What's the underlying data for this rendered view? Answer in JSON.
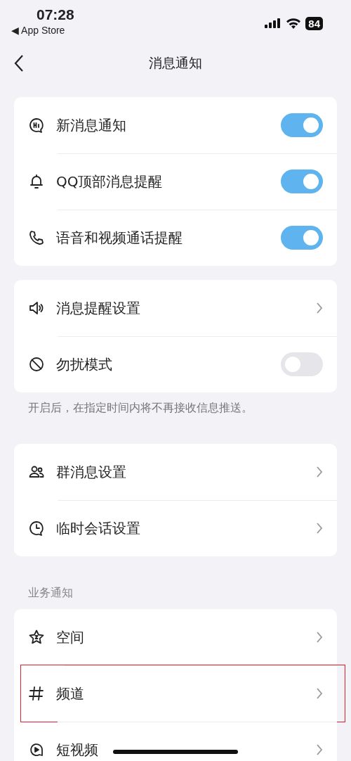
{
  "status_bar": {
    "time": "07:28",
    "back_app": "◀ App Store",
    "battery": "84"
  },
  "nav": {
    "title": "消息通知"
  },
  "groups": [
    {
      "rows": [
        {
          "kind": "toggle",
          "label": "新消息通知",
          "on": true
        },
        {
          "kind": "toggle",
          "label": "QQ顶部消息提醒",
          "on": true
        },
        {
          "kind": "toggle",
          "label": "语音和视频通话提醒",
          "on": true
        }
      ]
    },
    {
      "rows": [
        {
          "kind": "link",
          "label": "消息提醒设置"
        },
        {
          "kind": "toggle",
          "label": "勿扰模式",
          "on": false
        }
      ],
      "note": "开启后，在指定时间内将不再接收信息推送。"
    },
    {
      "rows": [
        {
          "kind": "link",
          "label": "群消息设置"
        },
        {
          "kind": "link",
          "label": "临时会话设置"
        }
      ]
    },
    {
      "header": "业务通知",
      "rows": [
        {
          "kind": "link",
          "label": "空间",
          "highlighted": false
        },
        {
          "kind": "link",
          "label": "频道",
          "highlighted": true
        },
        {
          "kind": "link",
          "label": "短视频",
          "highlighted": false
        }
      ]
    }
  ]
}
